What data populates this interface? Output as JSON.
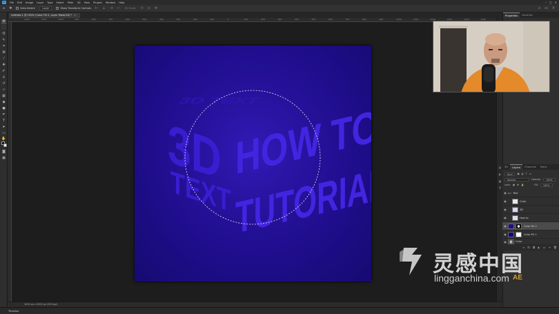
{
  "app": {
    "menu": [
      "File",
      "Edit",
      "Image",
      "Layer",
      "Type",
      "Select",
      "Filter",
      "3D",
      "View",
      "Plugins",
      "Window",
      "Help"
    ],
    "logo": "Ps"
  },
  "options_bar": {
    "auto_select_label": "Auto-Select:",
    "auto_select_value": "Layer",
    "transform_controls_label": "Show Transform Controls",
    "mode_label": "3D Mode:"
  },
  "document": {
    "tab_title": "Untitled-1 @ 100% (Color Fill 2, Layer Mask/16) *",
    "status": "2000 px x 2000 px (300 ppi)"
  },
  "artwork": {
    "left_face_text": [
      "3D",
      "TEXT"
    ],
    "right_face_text": [
      "HOW TO",
      "TUTORIAL"
    ],
    "top_face_text": "3D TEXT"
  },
  "ruler_labels": [
    "1200",
    "1100",
    "1000",
    "900",
    "800",
    "700",
    "600",
    "500",
    "400",
    "300",
    "200",
    "100",
    "0",
    "100",
    "200",
    "300",
    "400",
    "500",
    "600",
    "700",
    "800",
    "900",
    "1000",
    "1100",
    "1200",
    "1300",
    "1400",
    "1500",
    "1600"
  ],
  "right_panel": {
    "tabs": [
      "Properties",
      "Libraries"
    ]
  },
  "layers_panel": {
    "tabs": [
      "3D",
      "Layers",
      "Channels",
      "Paths"
    ],
    "kind_label": "Kind",
    "blend_mode": "Normal",
    "opacity_label": "Opacity:",
    "opacity_value": "100%",
    "lock_label": "Lock:",
    "fill_label": "Fill:",
    "fill_value": "100%",
    "layers": [
      {
        "name": "Text",
        "type": "group",
        "selected": false
      },
      {
        "name": "Color",
        "type": "layer",
        "selected": false
      },
      {
        "name": "3D",
        "type": "layer",
        "selected": false
      },
      {
        "name": "How to",
        "type": "layer",
        "selected": false
      },
      {
        "name": "Color Fill 2",
        "type": "fill",
        "selected": true
      },
      {
        "name": "Color Fill 1",
        "type": "fill",
        "selected": false
      },
      {
        "name": "Color",
        "type": "layer",
        "selected": false
      }
    ]
  },
  "timeline": {
    "label": "Timeline"
  },
  "watermark": {
    "cn_text": "灵感中国",
    "url_text": "lingganchina.com",
    "badge": "AE"
  },
  "colors": {
    "canvas_bg": "#1f0e8e",
    "text_blue": "#3f22d8",
    "app_bg": "#1e1e1e",
    "panel_bg": "#2f2f2f"
  }
}
